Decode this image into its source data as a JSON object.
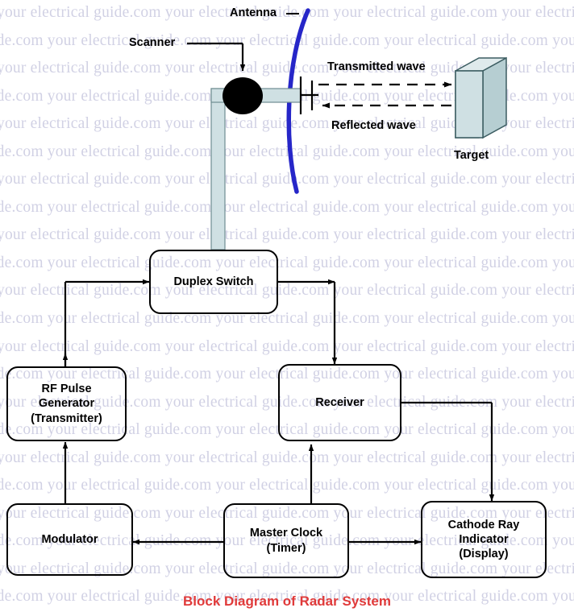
{
  "watermark": {
    "text": "your electrical guide.com ",
    "rows": 22,
    "color": "#c9c9e0"
  },
  "title": {
    "caption": "Block Diagram of Radar System",
    "color": "#e03a3a"
  },
  "labels": {
    "antenna": "Antenna",
    "scanner": "Scanner",
    "transmitted_wave": "Transmitted wave",
    "reflected_wave": "Reflected wave",
    "target": "Target"
  },
  "blocks": [
    {
      "id": "duplex-switch",
      "lines": [
        "Duplex Switch"
      ]
    },
    {
      "id": "rf-pulse-generator",
      "lines": [
        "RF Pulse",
        "Generator",
        "(Transmitter)"
      ]
    },
    {
      "id": "receiver",
      "lines": [
        "Receiver"
      ]
    },
    {
      "id": "modulator",
      "lines": [
        "Modulator"
      ]
    },
    {
      "id": "master-clock",
      "lines": [
        "Master Clock",
        "(Timer)"
      ]
    },
    {
      "id": "cathode-ray-indicator",
      "lines": [
        "Cathode Ray",
        "Indicator",
        "(Display)"
      ]
    }
  ],
  "colors": {
    "antenna_arc": "#2626c8",
    "waveguide_fill": "#cfe0e3",
    "waveguide_stroke": "#6f8d92",
    "scanner_dot": "#000000",
    "target_front": "#cfe0e3",
    "target_side": "#b6ced2",
    "target_stroke": "#3b5c61",
    "line": "#000000"
  }
}
